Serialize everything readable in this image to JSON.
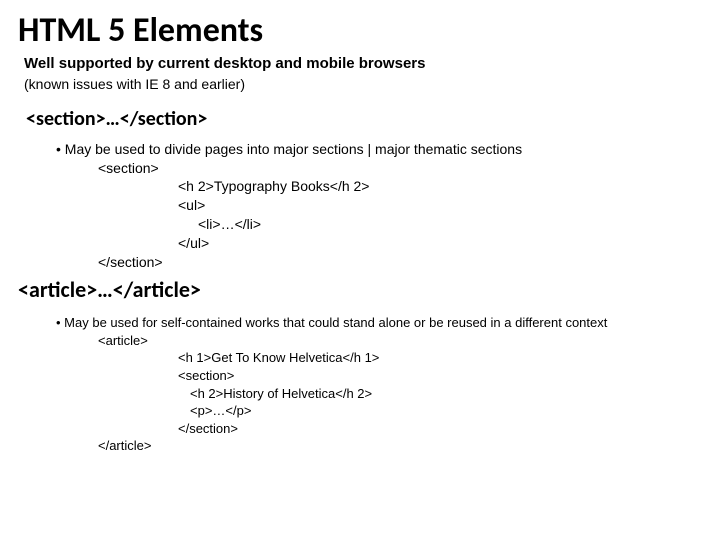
{
  "title": "HTML 5 Elements",
  "subtitle": "Well supported by current desktop and mobile browsers",
  "subtitle2": "(known issues with IE 8 and earlier)",
  "section1": {
    "heading": "<section>…</section>",
    "bullet": "• May be used to divide pages into major sections | major thematic sections",
    "code": {
      "l1": "<section>",
      "l2": "<h 2>Typography Books</h 2>",
      "l3": "<ul>",
      "l4": "<li>…</li>",
      "l5": "</ul>",
      "l6": "</section>"
    }
  },
  "section2": {
    "heading": "<article>…</article>",
    "bullet": "• May be used for self-contained works that could stand alone or be reused in a different context",
    "code": {
      "l1": "<article>",
      "l2": "<h 1>Get To Know Helvetica</h 1>",
      "l3": "<section>",
      "l4": "<h 2>History of Helvetica</h 2>",
      "l5": "<p>…</p>",
      "l6": "</section>",
      "l7": "</article>"
    }
  }
}
